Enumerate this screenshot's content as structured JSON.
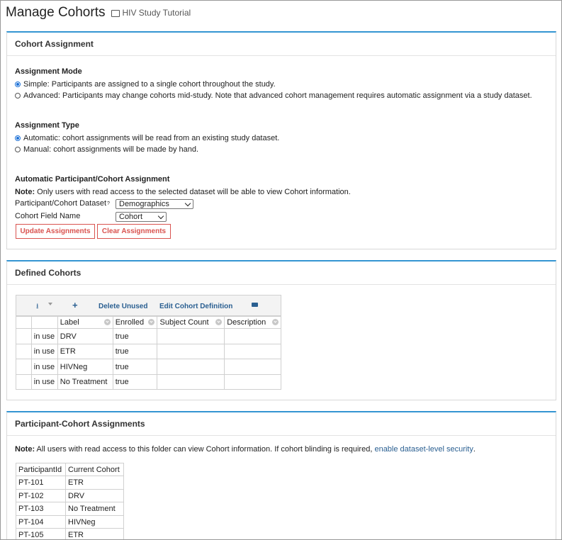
{
  "header": {
    "title": "Manage Cohorts",
    "folder": "HIV Study Tutorial"
  },
  "assignment": {
    "panel_title": "Cohort Assignment",
    "mode_heading": "Assignment Mode",
    "mode_simple": "Simple: Participants are assigned to a single cohort throughout the study.",
    "mode_advanced": "Advanced: Participants may change cohorts mid-study. Note that advanced cohort management requires automatic assignment via a study dataset.",
    "type_heading": "Assignment Type",
    "type_automatic": "Automatic: cohort assignments will be read from an existing study dataset.",
    "type_manual": "Manual: cohort assignments will be made by hand.",
    "auto_heading": "Automatic Participant/Cohort Assignment",
    "note_label": "Note:",
    "note_text": " Only users with read access to the selected dataset will be able to view Cohort information.",
    "dataset_label": "Participant/Cohort Dataset",
    "help_mark": "?",
    "dataset_value": "Demographics",
    "field_label": "Cohort Field Name",
    "field_value": "Cohort",
    "update_button": "Update Assignments",
    "clear_button": "Clear Assignments"
  },
  "defined": {
    "panel_title": "Defined Cohorts",
    "toolbar": {
      "plus": "+",
      "delete_unused": "Delete Unused",
      "edit_definition": "Edit Cohort Definition"
    },
    "columns": [
      "Label",
      "Enrolled",
      "Subject Count",
      "Description"
    ],
    "rows": [
      {
        "status": "in use",
        "label": "DRV",
        "enrolled": "true",
        "count": "",
        "description": ""
      },
      {
        "status": "in use",
        "label": "ETR",
        "enrolled": "true",
        "count": "",
        "description": ""
      },
      {
        "status": "in use",
        "label": "HIVNeg",
        "enrolled": "true",
        "count": "",
        "description": ""
      },
      {
        "status": "in use",
        "label": "No Treatment",
        "enrolled": "true",
        "count": "",
        "description": ""
      }
    ]
  },
  "participants": {
    "panel_title": "Participant-Cohort Assignments",
    "note_label": "Note:",
    "note_text": " All users with read access to this folder can view Cohort information. If cohort blinding is required, ",
    "note_link": "enable dataset-level security",
    "note_end": ".",
    "columns": [
      "ParticipantId",
      "Current Cohort"
    ],
    "rows": [
      {
        "id": "PT-101",
        "cohort": "ETR"
      },
      {
        "id": "PT-102",
        "cohort": "DRV"
      },
      {
        "id": "PT-103",
        "cohort": "No Treatment"
      },
      {
        "id": "PT-104",
        "cohort": "HIVNeg"
      },
      {
        "id": "PT-105",
        "cohort": "ETR"
      }
    ]
  }
}
